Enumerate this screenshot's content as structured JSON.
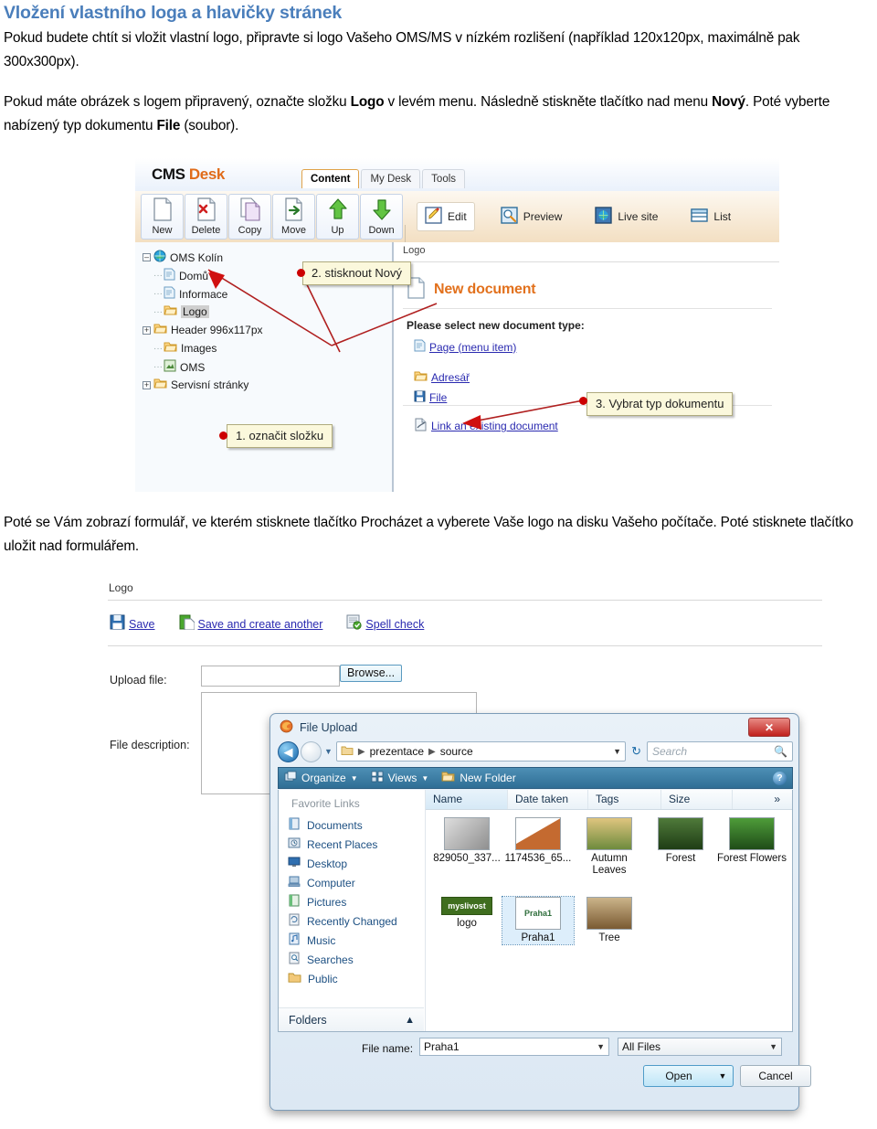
{
  "document": {
    "title": "Vložení vlastního loga a hlavičky stránek",
    "paragraph1_a": "Pokud budete chtít si vložit vlastní logo, připravte si logo Vašeho OMS/MS v nízkém rozlišení (například 120x120px, maximálně pak 300x300px).",
    "paragraph2_a": "Pokud máte obrázek s logem připravený, označte složku ",
    "paragraph2_b1": "Logo",
    "paragraph2_c": " v levém menu. Následně stiskněte tlačítko nad menu ",
    "paragraph2_b2": "Nový",
    "paragraph2_d": ". Poté vyberte nabízený  typ dokumentu ",
    "paragraph2_b3": "File",
    "paragraph2_e": " (soubor).",
    "paragraph3": "Poté se Vám zobrazí formulář, ve kterém stisknete tlačítko Procházet a vyberete Vaše logo na disku Vašeho počítače. Poté stisknete tlačítko uložit nad formulářem."
  },
  "cms_screenshot": {
    "logo_cms": "CMS",
    "logo_desk": "Desk",
    "tabs": [
      {
        "label": "Content",
        "active": true
      },
      {
        "label": "My Desk",
        "active": false
      },
      {
        "label": "Tools",
        "active": false
      }
    ],
    "toolbar_left": [
      {
        "label": "New",
        "icon": "new-document-icon"
      },
      {
        "label": "Delete",
        "icon": "delete-document-icon"
      },
      {
        "label": "Copy",
        "icon": "copy-document-icon"
      },
      {
        "label": "Move",
        "icon": "move-document-icon"
      },
      {
        "label": "Up",
        "icon": "arrow-up-icon"
      },
      {
        "label": "Down",
        "icon": "arrow-down-icon"
      }
    ],
    "toolbar_right": [
      {
        "label": "Edit",
        "icon": "edit-pencil-icon",
        "selected": true
      },
      {
        "label": "Preview",
        "icon": "magnifier-icon",
        "selected": false
      },
      {
        "label": "Live site",
        "icon": "globe-icon",
        "selected": false
      },
      {
        "label": "List",
        "icon": "list-icon",
        "selected": false
      }
    ],
    "tree": [
      {
        "label": "OMS Kolín",
        "icon": "globe-icon",
        "expander": "minus",
        "indent": 0,
        "selected": false
      },
      {
        "label": "Domů",
        "icon": "page-icon",
        "expander": "none",
        "indent": 1,
        "selected": false
      },
      {
        "label": "Informace",
        "icon": "page-icon",
        "expander": "none",
        "indent": 1,
        "selected": false
      },
      {
        "label": "Logo",
        "icon": "folder-icon",
        "expander": "none",
        "indent": 1,
        "selected": true
      },
      {
        "label": "Header 996x117px",
        "icon": "folder-icon",
        "expander": "plus",
        "indent": 1,
        "selected": false
      },
      {
        "label": "Images",
        "icon": "folder-icon",
        "expander": "none",
        "indent": 1,
        "selected": false
      },
      {
        "label": "OMS",
        "icon": "special-page-icon",
        "expander": "none",
        "indent": 1,
        "selected": false
      },
      {
        "label": "Servisní stránky",
        "icon": "folder-icon",
        "expander": "plus",
        "indent": 1,
        "selected": false
      }
    ],
    "breadcrumb": "Logo",
    "new_document_heading": "New document",
    "select_type_label": "Please select new document type:",
    "doc_types": [
      {
        "label": "Page (menu item)",
        "icon": "page-icon"
      },
      {
        "label": "Adresář",
        "icon": "folder-icon"
      },
      {
        "label": "File",
        "icon": "floppy-icon"
      }
    ],
    "link_existing": "Link an existing document",
    "callouts": [
      {
        "text": "1. označit složku"
      },
      {
        "text": "2. stisknout Nový"
      },
      {
        "text": "3. Vybrat typ dokumentu"
      }
    ]
  },
  "form_screenshot": {
    "title": "Logo",
    "actions": [
      {
        "label": "Save",
        "icon": "floppy-icon"
      },
      {
        "label": "Save and create another",
        "icon": "floppy-new-icon"
      },
      {
        "label": "Spell check",
        "icon": "spell-check-icon"
      }
    ],
    "upload_label": "Upload file:",
    "upload_value": "",
    "browse_label": "Browse...",
    "description_label": "File description:",
    "description_value": ""
  },
  "file_dialog": {
    "title": "File Upload",
    "app_icon": "firefox-icon",
    "close_label": "✕",
    "breadcrumb": [
      "prezentace",
      "source"
    ],
    "search_placeholder": "Search",
    "commands": [
      {
        "label": "Organize",
        "icon": "organize-icon",
        "has_caret": true
      },
      {
        "label": "Views",
        "icon": "views-icon",
        "has_caret": true
      },
      {
        "label": "New Folder",
        "icon": "new-folder-icon",
        "has_caret": false
      }
    ],
    "favorites_header": "Favorite Links",
    "favorites": [
      {
        "label": "Documents",
        "icon": "documents-icon"
      },
      {
        "label": "Recent Places",
        "icon": "recent-places-icon"
      },
      {
        "label": "Desktop",
        "icon": "desktop-icon"
      },
      {
        "label": "Computer",
        "icon": "computer-icon"
      },
      {
        "label": "Pictures",
        "icon": "pictures-icon"
      },
      {
        "label": "Recently Changed",
        "icon": "recently-changed-icon"
      },
      {
        "label": "Music",
        "icon": "music-icon"
      },
      {
        "label": "Searches",
        "icon": "searches-icon"
      },
      {
        "label": "Public",
        "icon": "public-folder-icon"
      }
    ],
    "folders_label": "Folders",
    "columns": [
      "Name",
      "Date taken",
      "Tags",
      "Size",
      "»"
    ],
    "files_row1": [
      {
        "name": "829050_337...",
        "color1": "#cfcfcf",
        "color2": "#8a8a8a",
        "selected": false
      },
      {
        "name": "1174536_65...",
        "color1": "#ffffff",
        "color2": "#c46a30",
        "selected": false
      },
      {
        "name": "Autumn Leaves",
        "color1": "#d8c07a",
        "color2": "#6e8b3d",
        "selected": false
      },
      {
        "name": "Forest",
        "color1": "#4f7a3a",
        "color2": "#24471c",
        "selected": false
      },
      {
        "name": "Forest Flowers",
        "color1": "#3e7d2e",
        "color2": "#1f4c18",
        "selected": false
      }
    ],
    "files_row2": [
      {
        "name": "logo",
        "color1": "#3f6e1f",
        "color2": "#2d5214",
        "selected": false,
        "thumb_text": "myslivost"
      },
      {
        "name": "Praha1",
        "color1": "#ffffff",
        "color2": "#f2f2f2",
        "selected": true,
        "thumb_text": "Praha1"
      },
      {
        "name": "Tree",
        "color1": "#cbb48a",
        "color2": "#7a5a32",
        "selected": false
      }
    ],
    "file_name_label": "File name:",
    "file_name_value": "Praha1",
    "file_type_value": "All Files",
    "open_label": "Open",
    "cancel_label": "Cancel"
  },
  "colors": {
    "heading_blue": "#4a7ebb",
    "accent_orange": "#e2711d",
    "link_blue": "#2a2ab0",
    "callout_bg": "#fbf8dc",
    "callout_dot": "#cc0000"
  }
}
